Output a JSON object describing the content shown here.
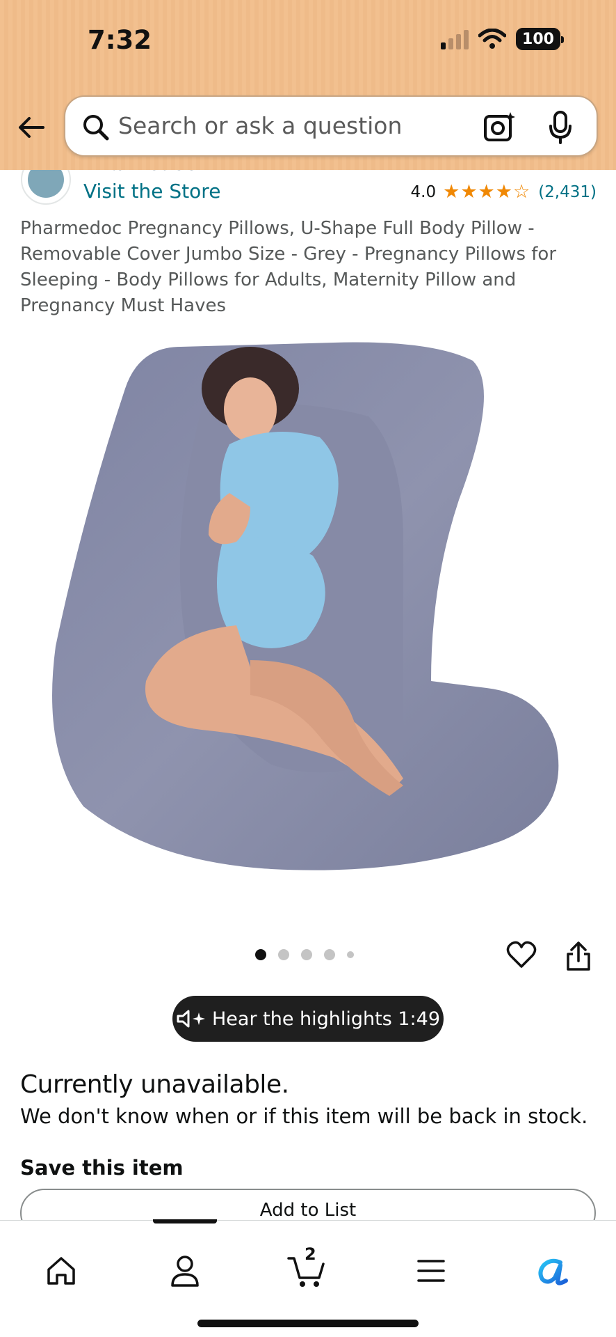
{
  "status_bar": {
    "time": "7:32",
    "battery": "100"
  },
  "search": {
    "placeholder": "Search or ask a question"
  },
  "store": {
    "name": "Pharmedoc",
    "visit_label": "Visit the Store"
  },
  "rating": {
    "value": "4.0",
    "stars": 4,
    "max_stars": 5,
    "count": "(2,431)"
  },
  "product": {
    "title": "Pharmedoc Pregnancy Pillows, U-Shape Full Body Pillow - Removable Cover Jumbo Size - Grey - Pregnancy Pillows for Sleeping - Body Pillows for Adults, Maternity Pillow and Pregnancy Must Haves"
  },
  "carousel": {
    "total_images": 5,
    "active_index": 0
  },
  "audio": {
    "label": "Hear the highlights 1:49"
  },
  "availability": {
    "status": "Currently unavailable.",
    "message": "We don't know when or if this item will be back in stock."
  },
  "save": {
    "heading": "Save this item",
    "add_to_list_label": "Add to List"
  },
  "bottom_nav": {
    "cart_count": "2",
    "active_tab": "account"
  },
  "colors": {
    "header_bg": "#f2c08f",
    "link": "#007185",
    "star": "#f08804",
    "pillow": "#8a8ea8"
  }
}
